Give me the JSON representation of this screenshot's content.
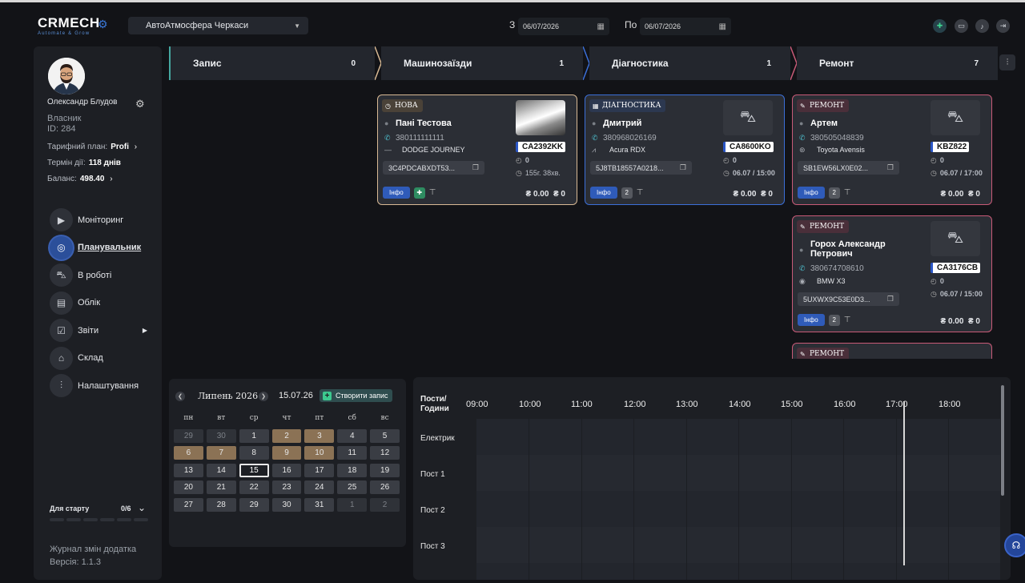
{
  "header": {
    "logo_main": "CRMECH",
    "logo_sub": "Automate & Grow",
    "station": "АвтоАтмосфера Черкаси",
    "date_from_label": "З",
    "date_from": "06/07/2026",
    "date_to_label": "По",
    "date_to": "06/07/2026"
  },
  "user": {
    "name": "Олександр Блудов",
    "role": "Власник",
    "id_label": "ID: 284",
    "plan_label": "Тарифний план:",
    "plan_value": "Profi",
    "term_label": "Термін дії:",
    "term_value": "118 днів",
    "balance_label": "Баланс:",
    "balance_value": "498.40"
  },
  "menu": [
    {
      "label": "Моніторинг",
      "icon": "camera-icon"
    },
    {
      "label": "Планувальник",
      "icon": "globe-icon"
    },
    {
      "label": "В роботі",
      "icon": "car-icon"
    },
    {
      "label": "Облік",
      "icon": "document-icon"
    },
    {
      "label": "Звіти",
      "icon": "report-icon"
    },
    {
      "label": "Склад",
      "icon": "warehouse-icon"
    },
    {
      "label": "Налаштування",
      "icon": "sliders-icon"
    }
  ],
  "start": {
    "label": "Для старту",
    "count": "0/6"
  },
  "footer": {
    "journal": "Журнал змін додатка",
    "version": "Версія: 1.1.3"
  },
  "columns": [
    {
      "title": "Запис",
      "count": "0"
    },
    {
      "title": "Машинозаїзди",
      "count": "1"
    },
    {
      "title": "Діагностика",
      "count": "1"
    },
    {
      "title": "Ремонт",
      "count": "7"
    }
  ],
  "cards": {
    "c1": {
      "status": "НОВА",
      "name": "Пані Тестова",
      "phone": "380111111111",
      "car": "DODGE JOURNEY",
      "vin": "3C4PDCABXDT53...",
      "plate": "CA2392KK",
      "count": "0",
      "time": "155г. 38хв.",
      "info": "Інфо",
      "money1": "₴ 0.00",
      "money2": "₴ 0"
    },
    "c2": {
      "status": "ДІАГНОСТИКА",
      "name": "Дмитрий",
      "phone": "380968026169",
      "car": "Acura RDX",
      "vin": "5J8TB18557A0218...",
      "plate": "CA8600KO",
      "count": "0",
      "time": "06.07 / 15:00",
      "info": "Інфо",
      "badge": "2",
      "money1": "₴ 0.00",
      "money2": "₴ 0"
    },
    "c3": {
      "status": "РЕМОНТ",
      "name": "Артем",
      "phone": "380505048839",
      "car": "Toyota Avensis",
      "vin": "SB1EW56LX0E02...",
      "plate": "KBZ822",
      "count": "0",
      "time": "06.07 / 17:00",
      "info": "Інфо",
      "badge": "2",
      "money1": "₴ 0.00",
      "money2": "₴ 0"
    },
    "c4": {
      "status": "РЕМОНТ",
      "name": "Горох Александр Петрович",
      "phone": "380674708610",
      "car": "BMW X3",
      "vin": "5UXWX9C53E0D3...",
      "plate": "CA3176CB",
      "count": "0",
      "time": "06.07 / 15:00",
      "info": "Інфо",
      "badge": "2",
      "money1": "₴ 0.00",
      "money2": "₴ 0"
    },
    "c5": {
      "status": "РЕМОНТ"
    }
  },
  "calendar": {
    "month": "Липень 2026",
    "selected": "15.07.26",
    "create_label": "Створити запис",
    "dows": [
      "пн",
      "вт",
      "ср",
      "чт",
      "пт",
      "сб",
      "вс"
    ],
    "weeks": [
      [
        "29",
        "30",
        "1",
        "2",
        "3",
        "4",
        "5"
      ],
      [
        "6",
        "7",
        "8",
        "9",
        "10",
        "11",
        "12"
      ],
      [
        "13",
        "14",
        "15",
        "16",
        "17",
        "18",
        "19"
      ],
      [
        "20",
        "21",
        "22",
        "23",
        "24",
        "25",
        "26"
      ],
      [
        "27",
        "28",
        "29",
        "30",
        "31",
        "1",
        "2"
      ]
    ]
  },
  "timeline": {
    "head": "Пости/ Години",
    "hours": [
      "09:00",
      "10:00",
      "11:00",
      "12:00",
      "13:00",
      "14:00",
      "15:00",
      "16:00",
      "17:00",
      "18:00"
    ],
    "rows": [
      "Електрик",
      "Пост 1",
      "Пост 2",
      "Пост 3"
    ]
  }
}
